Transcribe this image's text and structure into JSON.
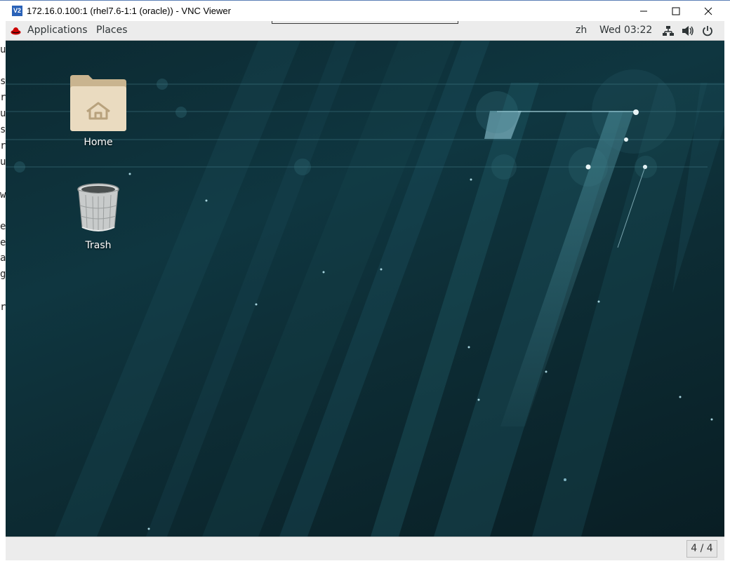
{
  "window": {
    "title": "172.16.0.100:1 (rhel7.6-1:1 (oracle)) - VNC Viewer",
    "icon_text": "V2"
  },
  "left_strip_chars": [
    "r",
    "u",
    "s",
    "r",
    "u",
    "s",
    "r",
    "u",
    "w",
    "e",
    "e",
    "a",
    "g",
    "r"
  ],
  "topbar": {
    "applications": "Applications",
    "places": "Places",
    "input_method": "zh",
    "clock": "Wed 03:22"
  },
  "desktop": {
    "icons": [
      {
        "label": "Home"
      },
      {
        "label": "Trash"
      }
    ]
  },
  "bottombar": {
    "workspace": "4 / 4"
  },
  "colors": {
    "accent": "#2a62b8",
    "desktop_bg": "#0f3640",
    "panel": "#ececec"
  }
}
